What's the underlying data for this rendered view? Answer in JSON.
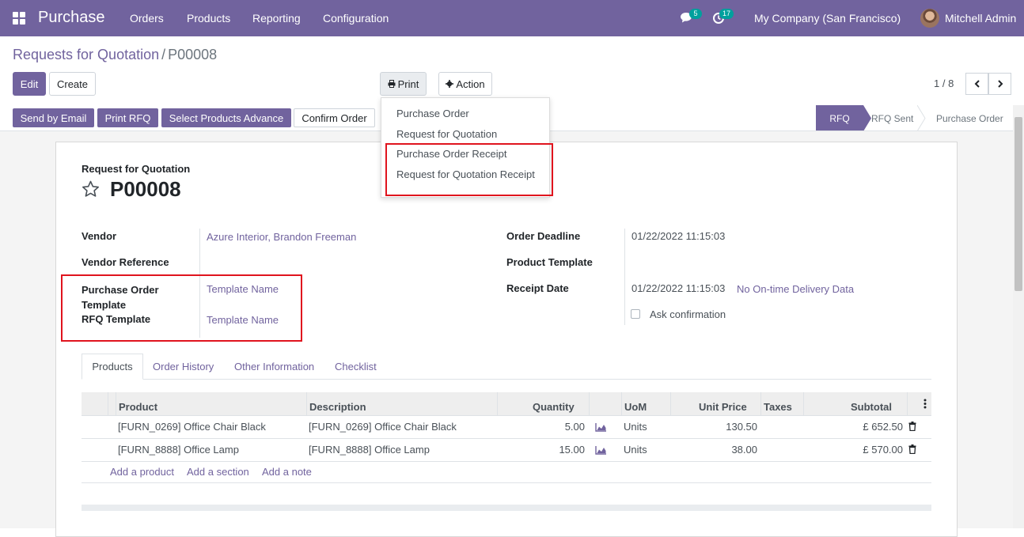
{
  "navbar": {
    "app_name": "Purchase",
    "menus": [
      "Orders",
      "Products",
      "Reporting",
      "Configuration"
    ],
    "chat_count": "5",
    "activity_count": "17",
    "company": "My Company (San Francisco)",
    "user": "Mitchell Admin"
  },
  "breadcrumb": {
    "parent": "Requests for Quotation",
    "separator": "/",
    "current": "P00008"
  },
  "control": {
    "edit_label": "Edit",
    "create_label": "Create",
    "print_label": "Print",
    "action_label": "Action",
    "pager": "1 / 8"
  },
  "print_menu": [
    "Purchase Order",
    "Request for Quotation",
    "Purchase Order Receipt",
    "Request for Quotation Receipt"
  ],
  "header_buttons": [
    "Send by Email",
    "Print RFQ",
    "Select Products Advance",
    "Confirm Order"
  ],
  "stages": [
    "RFQ",
    "RFQ Sent",
    "Purchase Order"
  ],
  "form": {
    "doc_type": "Request for Quotation",
    "name": "P00008",
    "vendor_label": "Vendor",
    "vendor": "Azure Interior, Brandon Freeman",
    "vendor_ref_label": "Vendor Reference",
    "po_template_label_1": "Purchase Order",
    "po_template_label_2": "Template",
    "po_template": "Template Name",
    "rfq_template_label": "RFQ Template",
    "rfq_template": "Template Name",
    "deadline_label": "Order Deadline",
    "deadline": "01/22/2022 11:15:03",
    "product_template_label": "Product Template",
    "receipt_label": "Receipt Date",
    "receipt": "01/22/2022 11:15:03",
    "ontime": "No On-time Delivery Data",
    "ask_confirmation": "Ask confirmation"
  },
  "tabs": [
    "Products",
    "Order History",
    "Other Information",
    "Checklist"
  ],
  "table": {
    "headers": [
      "Product",
      "Description",
      "Quantity",
      "UoM",
      "Unit Price",
      "Taxes",
      "Subtotal"
    ],
    "rows": [
      {
        "product": "[FURN_0269] Office Chair Black",
        "description": "[FURN_0269] Office Chair Black",
        "quantity": "5.00",
        "uom": "Units",
        "price": "130.50",
        "subtotal": "£ 652.50"
      },
      {
        "product": "[FURN_8888] Office Lamp",
        "description": "[FURN_8888] Office Lamp",
        "quantity": "15.00",
        "uom": "Units",
        "price": "38.00",
        "subtotal": "£ 570.00"
      }
    ],
    "add_links": [
      "Add a product",
      "Add a section",
      "Add a note"
    ]
  }
}
